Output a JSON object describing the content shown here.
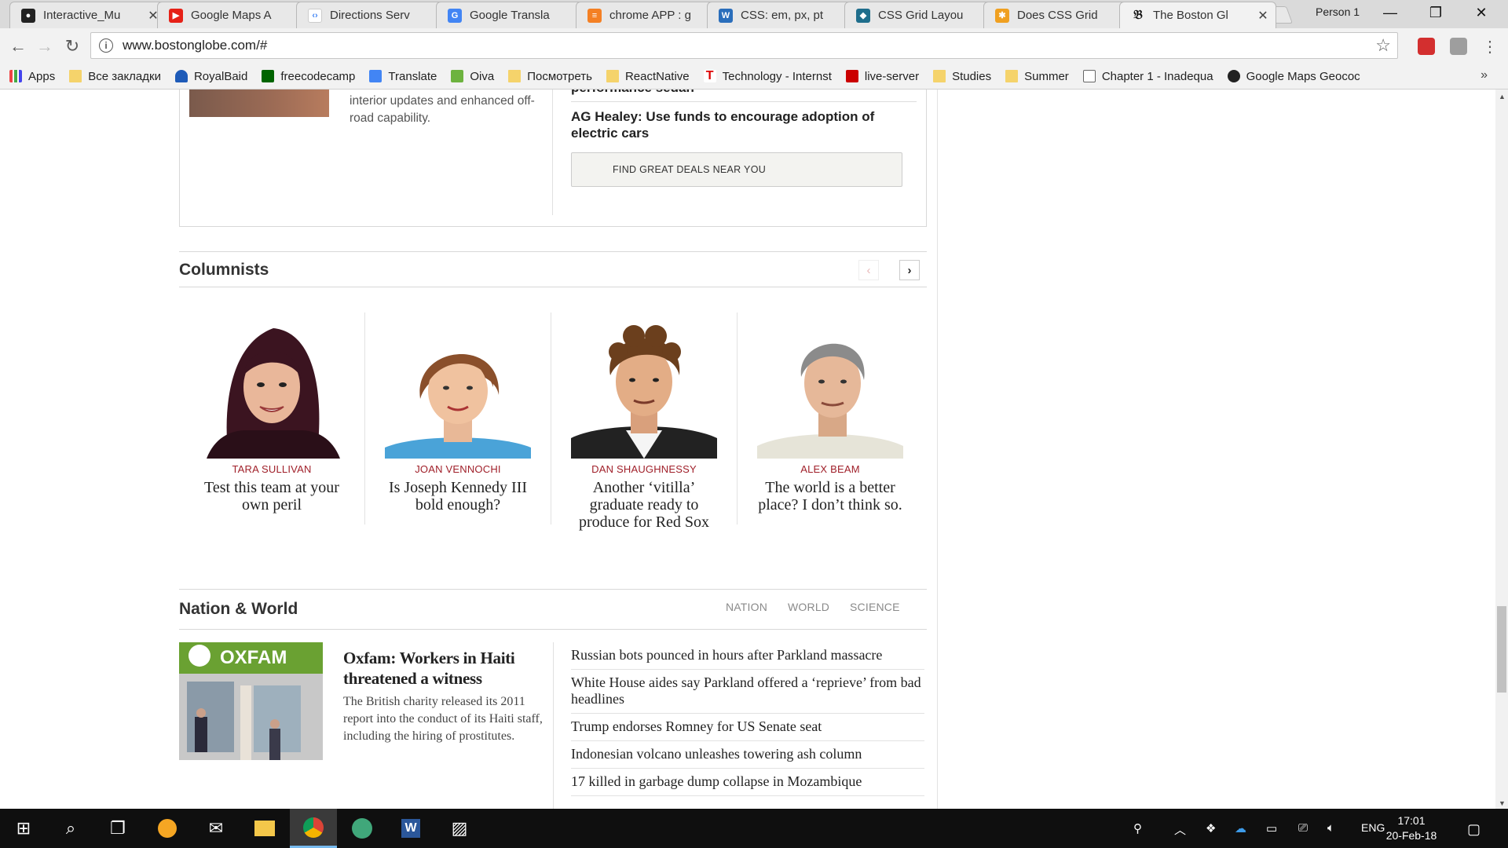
{
  "browser": {
    "tabs": [
      {
        "title": "Interactive_Mu",
        "icon": "github-icon",
        "color": "#222222"
      },
      {
        "title": "Google Maps A",
        "icon": "youtube-icon",
        "color": "#e62117"
      },
      {
        "title": "Directions Serv",
        "icon": "google-dev-icon",
        "color": "#4285f4"
      },
      {
        "title": "Google Transla",
        "icon": "google-translate-icon",
        "color": "#4285f4"
      },
      {
        "title": "chrome APP : g",
        "icon": "stackoverflow-icon",
        "color": "#f48024"
      },
      {
        "title": "CSS: em, px, pt",
        "icon": "w3schools-icon",
        "color": "#2a6ebb"
      },
      {
        "title": "CSS Grid Layou",
        "icon": "cssgrid-icon",
        "color": "#1f6e8c"
      },
      {
        "title": "Does CSS Grid",
        "icon": "sitepoint-icon",
        "color": "#f0a020"
      },
      {
        "title": "The Boston Gl",
        "icon": "boston-globe-icon",
        "color": "#111111"
      }
    ],
    "person": "Person 1",
    "url": "www.bostonglobe.com/#",
    "bookmarks": [
      {
        "label": "Apps",
        "icon": "apps-icon"
      },
      {
        "label": "Все закладки",
        "icon": "folder-icon"
      },
      {
        "label": "RoyalBaid",
        "icon": "onedrive-icon"
      },
      {
        "label": "freecodecamp",
        "icon": "freecodecamp-icon"
      },
      {
        "label": "Translate",
        "icon": "google-translate-icon"
      },
      {
        "label": "Oiva",
        "icon": "oiva-icon"
      },
      {
        "label": "Посмотреть",
        "icon": "folder-icon"
      },
      {
        "label": "ReactNative",
        "icon": "folder-icon"
      },
      {
        "label": "Technology - Internst",
        "icon": "technology-icon"
      },
      {
        "label": "live-server",
        "icon": "npm-icon"
      },
      {
        "label": "Studies",
        "icon": "folder-icon"
      },
      {
        "label": "Summer",
        "icon": "folder-icon"
      },
      {
        "label": "Chapter 1 - Inadequa",
        "icon": "page-icon"
      },
      {
        "label": "Google Maps Geococ",
        "icon": "maps-geocoder-icon"
      }
    ],
    "more_label": "»"
  },
  "autos": {
    "summary": "interior updates and enhanced off-road capability.",
    "cutoff_headline": "performance sedan",
    "headline": "AG Healey: Use funds to encourage adoption of electric cars",
    "deals_button": "FIND GREAT DEALS NEAR YOU"
  },
  "columnists": {
    "title": "Columnists",
    "items": [
      {
        "name": "TARA SULLIVAN",
        "headline": "Test this team at your own peril"
      },
      {
        "name": "JOAN VENNOCHI",
        "headline": "Is Joseph Kennedy III bold enough?"
      },
      {
        "name": "DAN SHAUGHNESSY",
        "headline": "Another ‘vitilla’ graduate ready to produce for Red Sox"
      },
      {
        "name": "ALEX BEAM",
        "headline": "The world is a better place? I don’t think so."
      }
    ]
  },
  "nation_world": {
    "title": "Nation & World",
    "nav": [
      "NATION",
      "WORLD",
      "SCIENCE"
    ],
    "lead": {
      "headline": "Oxfam: Workers in Haiti threatened a witness",
      "summary": "The British charity released its 2011 report into the conduct of its Haiti staff, including the hiring of prostitutes.",
      "image_sign": "OXFAM"
    },
    "headlines": [
      "Russian bots pounced in hours after Parkland massacre",
      "White House aides say Parkland offered a ‘reprieve’ from bad headlines",
      "Trump endorses Romney for US Senate seat",
      "Indonesian volcano unleashes towering ash column",
      "17 killed in garbage dump collapse in Mozambique"
    ]
  },
  "taskbar": {
    "language": "ENG",
    "time": "17:01",
    "date": "20-Feb-18"
  }
}
